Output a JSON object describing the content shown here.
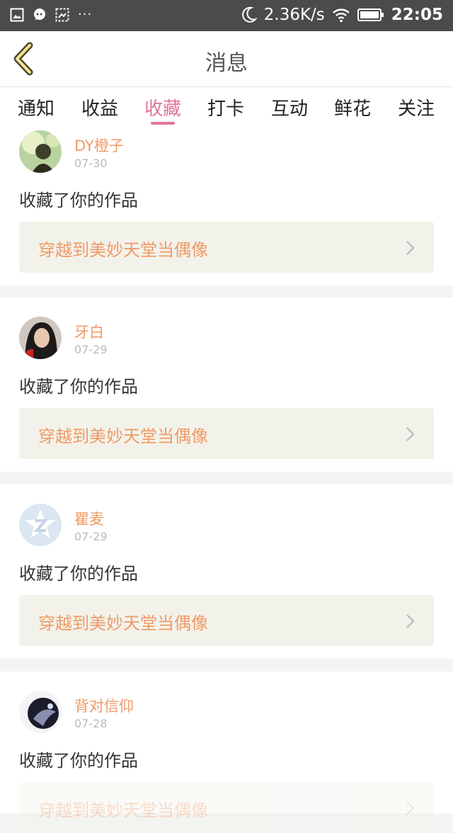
{
  "status_bar": {
    "speed": "2.36K/s",
    "time": "22:05",
    "dots": "···"
  },
  "header": {
    "title": "消息"
  },
  "tabs": [
    {
      "label": "通知"
    },
    {
      "label": "收益"
    },
    {
      "label": "收藏",
      "active": true
    },
    {
      "label": "打卡"
    },
    {
      "label": "互动"
    },
    {
      "label": "鲜花"
    },
    {
      "label": "关注"
    }
  ],
  "colors": {
    "accent_tab": "#e0749a",
    "username": "#f09a66",
    "work_bg": "#f3f2ea"
  },
  "notifications": [
    {
      "user": "DY橙子",
      "date": "07-30",
      "action": "收藏了你的作品",
      "work": "穿越到美妙天堂当偶像"
    },
    {
      "user": "牙白",
      "date": "07-29",
      "action": "收藏了你的作品",
      "work": "穿越到美妙天堂当偶像"
    },
    {
      "user": "瞿麦",
      "date": "07-29",
      "action": "收藏了你的作品",
      "work": "穿越到美妙天堂当偶像"
    },
    {
      "user": "背对信仰",
      "date": "07-28",
      "action": "收藏了你的作品",
      "work": "穿越到美妙天堂当偶像"
    }
  ]
}
